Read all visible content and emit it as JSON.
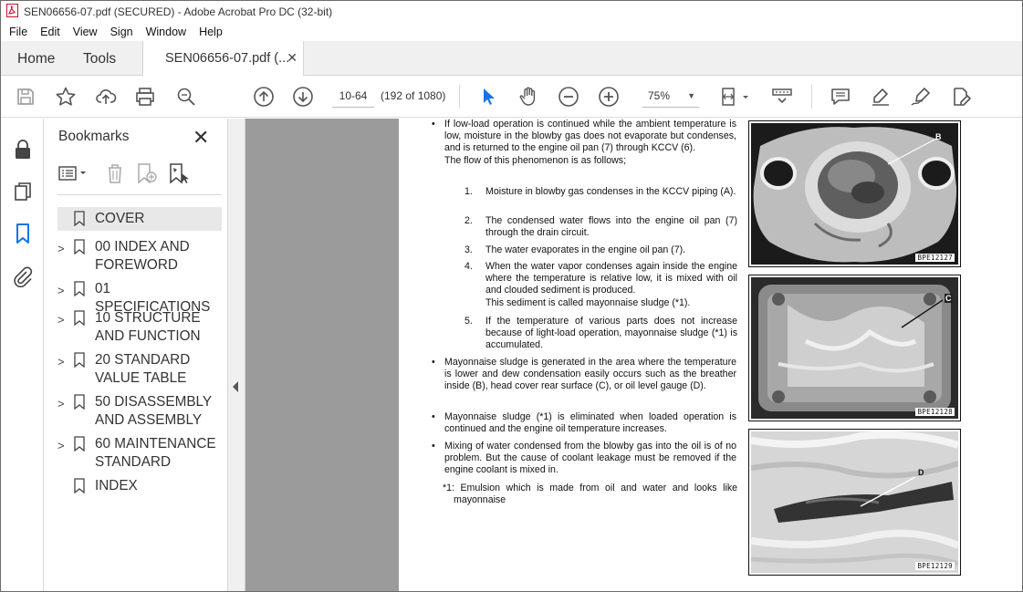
{
  "window": {
    "title": "SEN06656-07.pdf (SECURED) - Adobe Acrobat Pro DC (32-bit)"
  },
  "menu": [
    "File",
    "Edit",
    "View",
    "Sign",
    "Window",
    "Help"
  ],
  "tabs": {
    "home": "Home",
    "tools": "Tools",
    "doc": "SEN06656-07.pdf (..."
  },
  "toolbar": {
    "page_value": "10-64",
    "page_count": "(192 of 1080)",
    "zoom": "75%"
  },
  "bookmarks": {
    "title": "Bookmarks",
    "items": [
      {
        "label": "COVER",
        "expandable": false
      },
      {
        "label": "00 INDEX AND FOREWORD",
        "expandable": true
      },
      {
        "label": "01 SPECIFICATIONS",
        "expandable": true
      },
      {
        "label": "10 STRUCTURE AND FUNCTION",
        "expandable": true
      },
      {
        "label": "20 STANDARD VALUE TABLE",
        "expandable": true
      },
      {
        "label": "50 DISASSEMBLY AND ASSEMBLY",
        "expandable": true
      },
      {
        "label": "60 MAINTENANCE STANDARD",
        "expandable": true
      },
      {
        "label": "INDEX",
        "expandable": false
      }
    ]
  },
  "page": {
    "b1": "If low-load operation is continued while the ambient temperature is low, moisture in the blowby gas does not evaporate but condenses, and is returned to the engine oil pan (7) through KCCV (6).",
    "b1_flow": "The flow of this phenomenon is as follows;",
    "steps": [
      {
        "n": "1.",
        "text": "Moisture in blowby gas condenses in the KCCV piping (A)."
      },
      {
        "n": "2.",
        "text": "The condensed water flows into the engine oil pan (7) through the drain circuit."
      },
      {
        "n": "3.",
        "text": "The water evaporates in the engine oil pan (7)."
      },
      {
        "n": "4.",
        "text": "When the water vapor condenses again inside the engine where the temperature is relative low, it is mixed with oil and clouded sediment is produced."
      },
      {
        "n": "",
        "text": "This sediment is called mayonnaise sludge (*1)."
      },
      {
        "n": "5.",
        "text": "If the temperature of various parts does not increase because of light-load operation, mayonnaise sludge (*1) is accumulated."
      }
    ],
    "b2": "Mayonnaise sludge is generated in the area where the temperature is lower and dew condensation easily occurs such as the breather inside (B), head cover rear surface (C), or oil level gauge (D).",
    "b3": "Mayonnaise sludge (*1) is eliminated when loaded operation is continued and the engine oil temperature increases.",
    "b4": "Mixing of water condensed from the blowby gas into the oil is of no problem. But the cause of coolant leakage must be removed if the engine coolant is mixed in.",
    "footnote_mark": "*1:",
    "footnote": "Emulsion which is made from oil and water and looks like mayonnaise",
    "photos": [
      {
        "caption": "BPE12127",
        "marker": "B"
      },
      {
        "caption": "BPE12128",
        "marker": "C"
      },
      {
        "caption": "BPE12129",
        "marker": "D"
      }
    ]
  }
}
